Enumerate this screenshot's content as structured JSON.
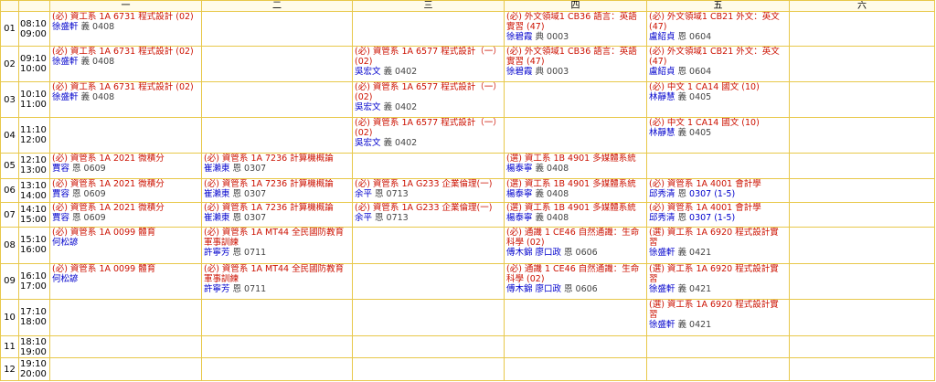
{
  "days": [
    "",
    "",
    "一",
    "二",
    "三",
    "四",
    "五",
    "六"
  ],
  "rows": [
    {
      "period": "01",
      "start": "08:10",
      "end": "09:00",
      "cells": [
        {
          "course": "(必) 資工系 1A 6731 程式設計 (02)",
          "teacher": "徐盛軒",
          "room": "義 0408"
        },
        null,
        null,
        {
          "course": "(必) 外文領域1 CB36 語言：英語實習 (47)",
          "teacher": "徐碧霞",
          "room": "典 0003"
        },
        {
          "course": "(必) 外文領域1 CB21 外文：英文 (47)",
          "teacher": "盧紹貞",
          "room": "恩 0604"
        },
        null
      ]
    },
    {
      "period": "02",
      "start": "09:10",
      "end": "10:00",
      "cells": [
        {
          "course": "(必) 資工系 1A 6731 程式設計 (02)",
          "teacher": "徐盛軒",
          "room": "義 0408"
        },
        null,
        {
          "course": "(必) 資管系 1A 6577 程式設計（一） (02)",
          "teacher": "吳宏文",
          "room": "義 0402"
        },
        {
          "course": "(必) 外文領域1 CB36 語言：英語實習 (47)",
          "teacher": "徐碧霞",
          "room": "典 0003"
        },
        {
          "course": "(必) 外文領域1 CB21 外文：英文 (47)",
          "teacher": "盧紹貞",
          "room": "恩 0604"
        },
        null
      ]
    },
    {
      "period": "03",
      "start": "10:10",
      "end": "11:00",
      "cells": [
        {
          "course": "(必) 資工系 1A 6731 程式設計 (02)",
          "teacher": "徐盛軒",
          "room": "義 0408"
        },
        null,
        {
          "course": "(必) 資管系 1A 6577 程式設計（一） (02)",
          "teacher": "吳宏文",
          "room": "義 0402"
        },
        null,
        {
          "course": "(必) 中文 1 CA14 國文 (10)",
          "teacher": "林靜慧",
          "room": "義 0405"
        },
        null
      ]
    },
    {
      "period": "04",
      "start": "11:10",
      "end": "12:00",
      "cells": [
        null,
        null,
        {
          "course": "(必) 資管系 1A 6577 程式設計（一） (02)",
          "teacher": "吳宏文",
          "room": "義 0402"
        },
        null,
        {
          "course": "(必) 中文 1 CA14 國文 (10)",
          "teacher": "林靜慧",
          "room": "義 0405"
        },
        null
      ]
    },
    {
      "period": "05",
      "start": "12:10",
      "end": "13:00",
      "cells": [
        {
          "course": "(必) 資管系 1A 2021 微積分",
          "teacher": "賈容",
          "room": "恩 0609"
        },
        {
          "course": "(必) 資管系 1A 7236 計算機概論",
          "teacher": "崔瀨東",
          "room": "恩 0307"
        },
        null,
        {
          "course": "(選) 資工系 1B 4901 多媒體系統",
          "teacher": "楊泰寧",
          "room": "義 0408"
        },
        null,
        null
      ]
    },
    {
      "period": "06",
      "start": "13:10",
      "end": "14:00",
      "cells": [
        {
          "course": "(必) 資管系 1A 2021 微積分",
          "teacher": "賈容",
          "room": "恩 0609"
        },
        {
          "course": "(必) 資管系 1A 7236 計算機概論",
          "teacher": "崔瀨東",
          "room": "恩 0307"
        },
        {
          "course": "(必) 資管系 1A G233 企業倫理(一)",
          "teacher": "余平",
          "room": "恩 0713"
        },
        {
          "course": "(選) 資工系 1B 4901 多媒體系統",
          "teacher": "楊泰寧",
          "room": "義 0408"
        },
        {
          "course": "(必) 資管系 1A 4001 會計學",
          "teacher": "邱秀清",
          "room": "恩",
          "note": "0307 (1-5)"
        },
        null
      ]
    },
    {
      "period": "07",
      "start": "14:10",
      "end": "15:00",
      "cells": [
        {
          "course": "(必) 資管系 1A 2021 微積分",
          "teacher": "賈容",
          "room": "恩 0609"
        },
        {
          "course": "(必) 資管系 1A 7236 計算機概論",
          "teacher": "崔瀨東",
          "room": "恩 0307"
        },
        {
          "course": "(必) 資管系 1A G233 企業倫理(一)",
          "teacher": "余平",
          "room": "恩 0713"
        },
        {
          "course": "(選) 資工系 1B 4901 多媒體系統",
          "teacher": "楊泰寧",
          "room": "義 0408"
        },
        {
          "course": "(必) 資管系 1A 4001 會計學",
          "teacher": "邱秀清",
          "room": "恩",
          "note": "0307 (1-5)"
        },
        null
      ]
    },
    {
      "period": "08",
      "start": "15:10",
      "end": "16:00",
      "cells": [
        {
          "course": "(必) 資管系 1A 0099 體育",
          "teacher": "何松諺",
          "room": ""
        },
        {
          "course": "(必) 資管系 1A MT44 全民國防教育軍事訓練",
          "teacher": "許寧芳",
          "room": "恩 0711"
        },
        null,
        {
          "course": "(必) 通識 1 CE46 自然通識：生命科學 (02)",
          "teacher": "傅木錦 廖口政",
          "room": "恩 0606"
        },
        {
          "course": "(選) 資工系 1A 6920 程式設計實習",
          "teacher": "徐盛軒",
          "room": "義 0421"
        },
        null
      ]
    },
    {
      "period": "09",
      "start": "16:10",
      "end": "17:00",
      "cells": [
        {
          "course": "(必) 資管系 1A 0099 體育",
          "teacher": "何松諺",
          "room": ""
        },
        {
          "course": "(必) 資管系 1A MT44 全民國防教育軍事訓練",
          "teacher": "許寧芳",
          "room": "恩 0711"
        },
        null,
        {
          "course": "(必) 通識 1 CE46 自然通識：生命科學 (02)",
          "teacher": "傅木錦 廖口政",
          "room": "恩 0606"
        },
        {
          "course": "(選) 資工系 1A 6920 程式設計實習",
          "teacher": "徐盛軒",
          "room": "義 0421"
        },
        null
      ]
    },
    {
      "period": "10",
      "start": "17:10",
      "end": "18:00",
      "cells": [
        null,
        null,
        null,
        null,
        {
          "course": "(選) 資工系 1A 6920 程式設計實習",
          "teacher": "徐盛軒",
          "room": "義 0421"
        },
        null
      ]
    },
    {
      "period": "11",
      "start": "18:10",
      "end": "19:00",
      "cells": [
        null,
        null,
        null,
        null,
        null,
        null
      ]
    },
    {
      "period": "12",
      "start": "19:10",
      "end": "20:00",
      "cells": [
        null,
        null,
        null,
        null,
        null,
        null
      ]
    }
  ]
}
